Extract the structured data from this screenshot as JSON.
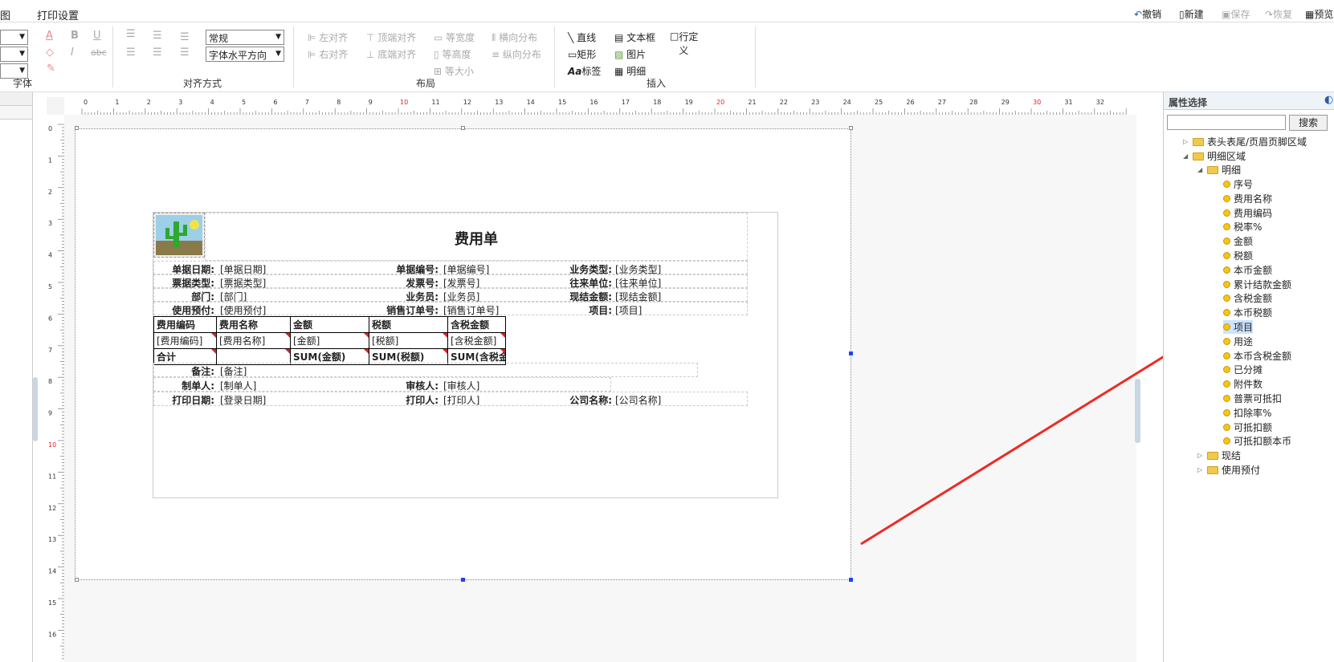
{
  "menu": {
    "item1": "图",
    "item2": "打印设置"
  },
  "topright": {
    "undo": "撤销",
    "new": "新建",
    "save": "保存",
    "redo": "恢复",
    "preview": "预览"
  },
  "ribbon": {
    "font_label": "字体",
    "align_label": "对齐方式",
    "layout_label": "布局",
    "insert_label": "插入",
    "style_select": "常规",
    "halign_select": "字体水平方向",
    "left_align": "左对齐",
    "right_align": "右对齐",
    "top_align": "顶端对齐",
    "bottom_align": "底端对齐",
    "equal_width": "等宽度",
    "equal_height": "等高度",
    "equal_size": "等大小",
    "h_distribute": "横向分布",
    "v_distribute": "纵向分布",
    "line": "直线",
    "textbox": "文本框",
    "row_def": "行定义",
    "rect": "矩形",
    "image": "图片",
    "label": "标签",
    "detail": "明细"
  },
  "ruler": {
    "h": [
      "0",
      "1",
      "2",
      "3",
      "4",
      "5",
      "6",
      "7",
      "8",
      "9",
      "10",
      "11",
      "12",
      "13",
      "14",
      "15",
      "16",
      "17",
      "18",
      "19",
      "20",
      "21",
      "22",
      "23",
      "24",
      "25",
      "26",
      "27",
      "28",
      "29",
      "30",
      "31",
      "32"
    ],
    "v": [
      "0",
      "1",
      "2",
      "3",
      "4",
      "5",
      "6",
      "7",
      "8",
      "9",
      "10",
      "11",
      "12",
      "13",
      "14",
      "15",
      "16"
    ]
  },
  "report": {
    "title": "费用单",
    "header": [
      [
        "单据日期:",
        "[单据日期]",
        "单据编号:",
        "[单据编号]",
        "业务类型:",
        "[业务类型]"
      ],
      [
        "票据类型:",
        "[票据类型]",
        "发票号:",
        "[发票号]",
        "往来单位:",
        "[往来单位]"
      ],
      [
        "部门:",
        "[部门]",
        "业务员:",
        "[业务员]",
        "现结金额:",
        "[现结金额]"
      ],
      [
        "使用预付:",
        "[使用预付]",
        "销售订单号:",
        "[销售订单号]",
        "项目:",
        "[项目]"
      ]
    ],
    "grid_head": [
      "费用编码",
      "费用名称",
      "金额",
      "税额",
      "含税金额"
    ],
    "grid_row": [
      "[费用编码]",
      "[费用名称]",
      "[金额]",
      "[税额]",
      "[含税金额]"
    ],
    "grid_sum": [
      "合计",
      "",
      "SUM(金额)",
      "SUM(税额)",
      "SUM(含税金"
    ],
    "remark_label": "备注:",
    "remark_val": "[备注]",
    "footer": [
      [
        "制单人:",
        "[制单人]",
        "审核人:",
        "[审核人]"
      ],
      [
        "打印日期:",
        "[登录日期]",
        "打印人:",
        "[打印人]",
        "公司名称:",
        "[公司名称]"
      ]
    ]
  },
  "panel": {
    "title": "属性选择",
    "search_btn": "搜索",
    "search_placeholder": "",
    "folder1": "表头表尾/页眉页脚区域",
    "folder2": "明细区域",
    "folder3": "明细",
    "fields": [
      "序号",
      "费用名称",
      "费用编码",
      "税率%",
      "金额",
      "税额",
      "本币金额",
      "累计结款金额",
      "含税金额",
      "本币税额",
      "项目",
      "用途",
      "本币含税金额",
      "已分摊",
      "附件数",
      "普票可抵扣",
      "扣除率%",
      "可抵扣额",
      "可抵扣额本币"
    ],
    "folder4": "现结",
    "folder5": "使用预付"
  },
  "colors": {
    "arrow": "#ee2a24",
    "selected_field": "#cde3ff"
  }
}
